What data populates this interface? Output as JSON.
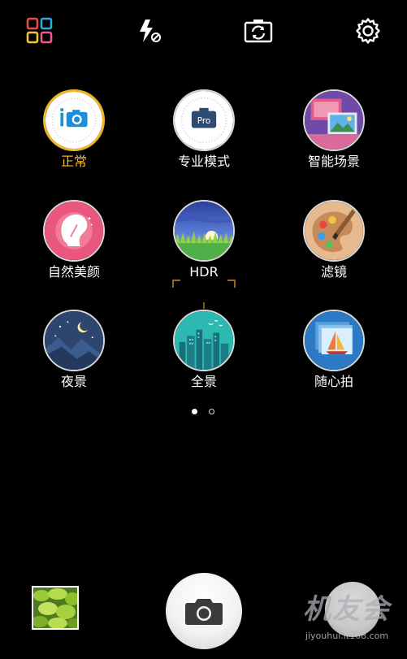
{
  "top_bar": {
    "icons": [
      "grid-icon",
      "flash-off-icon",
      "switch-camera-icon",
      "settings-icon"
    ]
  },
  "modes": [
    {
      "label": "正常",
      "icon": "camera-normal-icon",
      "active": true
    },
    {
      "label": "专业模式",
      "icon": "pro-icon",
      "badge": "Pro",
      "active": false
    },
    {
      "label": "智能场景",
      "icon": "smart-scene-icon",
      "active": false
    },
    {
      "label": "自然美颜",
      "icon": "beauty-icon",
      "active": false
    },
    {
      "label": "HDR",
      "icon": "hdr-icon",
      "active": false
    },
    {
      "label": "滤镜",
      "icon": "filter-palette-icon",
      "active": false
    },
    {
      "label": "夜景",
      "icon": "night-icon",
      "active": false
    },
    {
      "label": "全景",
      "icon": "panorama-icon",
      "active": false
    },
    {
      "label": "随心拍",
      "icon": "free-shot-icon",
      "active": false
    }
  ],
  "pager": {
    "pages": 2,
    "current": 1
  },
  "bottom_bar": {
    "gallery": "gallery-thumbnail",
    "shutter": "shutter-button",
    "video": "video-button"
  },
  "watermark": {
    "title": "机友会",
    "url": "jiyouhui.it168.com"
  },
  "colors": {
    "background": "#000000",
    "accent": "#f5b820",
    "text": "#ffffff"
  }
}
